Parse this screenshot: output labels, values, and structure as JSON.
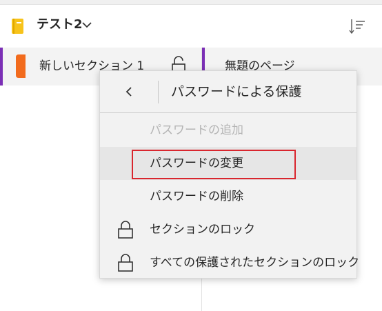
{
  "colors": {
    "accent": "#7b2fb5",
    "section_tab": "#f26b1d",
    "notebook_icon": "#f7c31b",
    "highlight": "#d9262e"
  },
  "header": {
    "notebook_name": "テスト2",
    "notebook_icon": "notebook-icon",
    "dropdown_icon": "chevron-down-icon",
    "sort_icon": "sort-icon"
  },
  "sections": {
    "items": [
      {
        "label": "新しいセクション 1",
        "icon": "section-tab-icon",
        "lock_icon": "unlocked-icon"
      }
    ]
  },
  "pages": {
    "items": [
      {
        "label": "無題のページ"
      }
    ]
  },
  "menu": {
    "title": "パスワードによる保護",
    "back_icon": "chevron-left-icon",
    "items": [
      {
        "label": "パスワードの追加",
        "disabled": true
      },
      {
        "label": "パスワードの変更",
        "highlighted": true
      },
      {
        "label": "パスワードの削除"
      },
      {
        "label": "セクションのロック",
        "icon": "lock-icon"
      },
      {
        "label": "すべての保護されたセクションのロック",
        "icon": "lock-icon"
      }
    ]
  }
}
